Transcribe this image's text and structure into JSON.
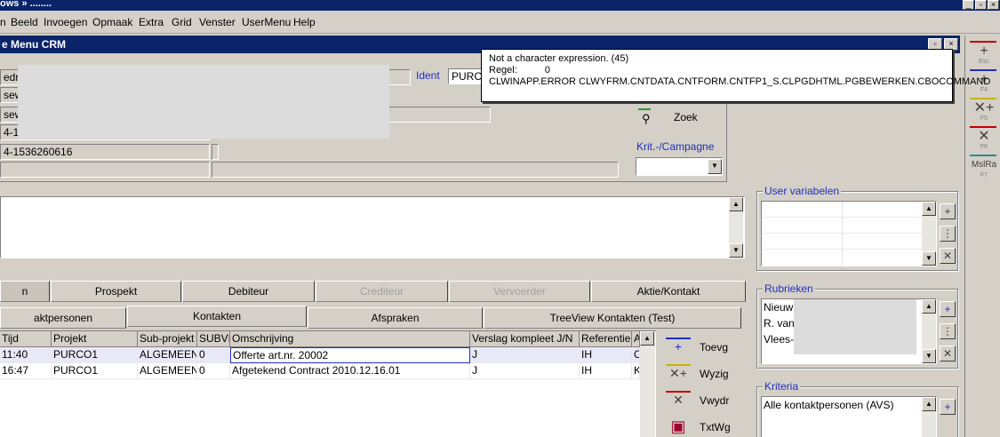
{
  "app": {
    "title": "ows  »  ........",
    "window_buttons": [
      "_",
      "▫",
      "×"
    ]
  },
  "menubar": {
    "items": [
      "n",
      "Beeld",
      "Invoegen",
      "Opmaak",
      "Extra",
      "Grid",
      "Venster",
      "UserMenu",
      "Help"
    ]
  },
  "window": {
    "title": "e Menu CRM"
  },
  "form": {
    "field1": "edriv",
    "field2": "sew",
    "field3": "sew",
    "field4": "4-15",
    "phone": "4-1536260616",
    "ident_label": "Ident",
    "ident_value": "PURC",
    "zoek_label": "Zoek",
    "krit_label": "Krit.-/Campagne",
    "krit_value": ""
  },
  "tooltip": {
    "line1": "Not a character expression. (45)",
    "line2_label": "Regel:",
    "line2_value": "0",
    "line3": "CLWINAPP.ERROR  CLWYFRM.CNTDATA.CNTFORM.CNTFP1_S.CLPGDHTML.PGBEWERKEN.CBOCOMMAND"
  },
  "right_toolbar": [
    {
      "icon": "plus-icon",
      "glyph": "+",
      "key": "Esc"
    },
    {
      "icon": "plus-icon",
      "glyph": "+",
      "key": "F4"
    },
    {
      "icon": "edit-plus-icon",
      "glyph": "✕+",
      "key": "F5"
    },
    {
      "icon": "delete-icon",
      "glyph": "✕",
      "key": "F6"
    },
    {
      "icon": "text-icon",
      "glyph": "MslRa",
      "key": "F7"
    }
  ],
  "user_variabelen": {
    "label": "User variabelen"
  },
  "rubrieken": {
    "label": "Rubrieken",
    "items": [
      "Nieuw",
      "R. van",
      "Vlees-"
    ]
  },
  "kriteria": {
    "label": "Kriteria",
    "items": [
      "Alle kontaktpersonen (AVS)"
    ]
  },
  "tabs_row1": [
    {
      "label": "n",
      "state": "selected"
    },
    {
      "label": "Prospekt",
      "state": "normal"
    },
    {
      "label": "Debiteur",
      "state": "normal"
    },
    {
      "label": "Crediteur",
      "state": "disabled"
    },
    {
      "label": "Vervoerder",
      "state": "disabled"
    },
    {
      "label": "Aktie/Kontakt",
      "state": "normal"
    }
  ],
  "tabs_row2": [
    {
      "label": "aktpersonen",
      "state": "normal"
    },
    {
      "label": "Kontakten",
      "state": "selected"
    },
    {
      "label": "Afspraken",
      "state": "normal"
    },
    {
      "label": "TreeView Kontakten (Test)",
      "state": "normal"
    }
  ],
  "grid": {
    "columns": [
      "Tijd",
      "Projekt",
      "Sub-projekt",
      "SUBVI",
      "Omschrijving",
      "Verslag kompleet J/N",
      "Referentie",
      "A"
    ],
    "rows": [
      [
        "11:40",
        "PURCO1",
        "ALGEMEEN",
        "0",
        "Offerte art.nr. 20002",
        "J",
        "IH",
        "C"
      ],
      [
        "16:47",
        "PURCO1",
        "ALGEMEEN",
        "0",
        "Afgetekend Contract 2010.12.16.01",
        "J",
        "IH",
        "K"
      ]
    ]
  },
  "actions": [
    {
      "icon": "add-icon",
      "glyph": "+",
      "label": "Toevg"
    },
    {
      "icon": "edit-icon",
      "glyph": "✕+",
      "label": "Wyzig"
    },
    {
      "icon": "delete-icon",
      "glyph": "✕",
      "label": "Vwydr"
    },
    {
      "icon": "text-window-icon",
      "glyph": "▣",
      "label": "TxtWg"
    }
  ],
  "colors": {
    "titlebar": "#0a246a",
    "label_blue": "#1f2fbf",
    "accent_red": "#c00000",
    "accent_yellow": "#c8b400"
  }
}
